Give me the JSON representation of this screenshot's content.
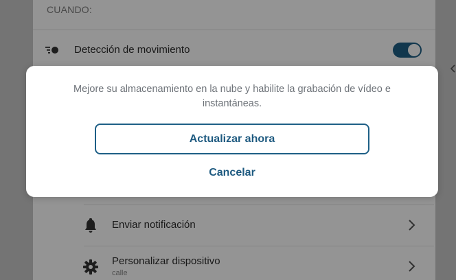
{
  "section": {
    "label": "CUANDO:"
  },
  "trigger": {
    "label": "Detección de movimiento",
    "icon": "motion-detection-icon",
    "enabled": true
  },
  "actions": [
    {
      "label": "Enviar notificación",
      "icon": "bell-icon"
    },
    {
      "label": "Personalizar dispositivo",
      "sublabel": "calle",
      "icon": "gear-icon"
    }
  ],
  "dialog": {
    "message": "Mejore su almacenamiento en la nube y habilite la grabación de vídeo e instantáneas.",
    "primary_label": "Actualizar ahora",
    "cancel_label": "Cancelar"
  },
  "colors": {
    "accent": "#1e5f86",
    "overlay": "rgba(0,0,0,0.42)"
  }
}
